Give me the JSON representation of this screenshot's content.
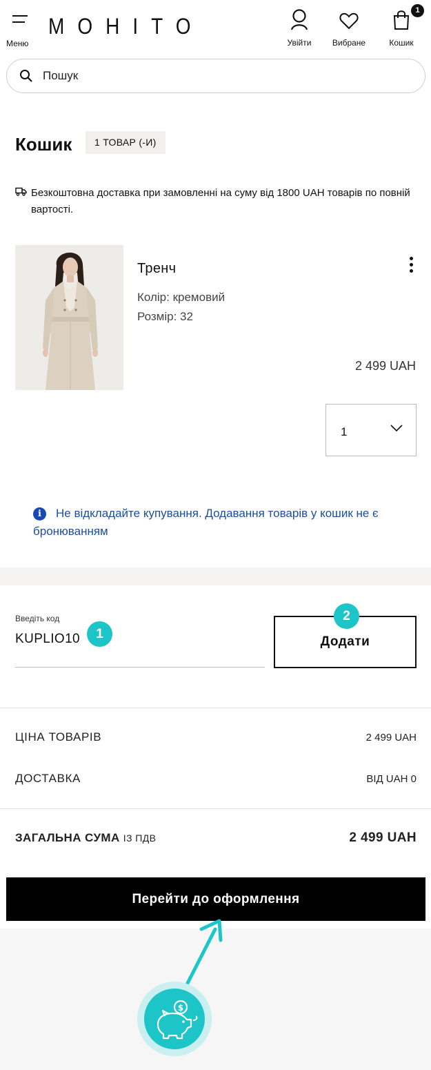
{
  "header": {
    "menu_label": "Меню",
    "logo": "MOHITO",
    "login_label": "Увійти",
    "favorites_label": "Вибране",
    "cart_label": "Кошик",
    "cart_count": "1"
  },
  "search": {
    "placeholder": "Пошук"
  },
  "cart": {
    "title": "Кошик",
    "count_badge": "1 ТОВАР (-И)",
    "delivery_note": "Безкоштовна доставка при замовленні на суму від 1800 UAH товарів по повній вартості."
  },
  "product": {
    "name": "Тренч",
    "color": "Колір: кремовий",
    "size": "Розмір: 32",
    "price": "2 499 UAH",
    "quantity": "1"
  },
  "info_note": "Не відкладайте купування. Додавання товарів у кошик не є бронюванням",
  "promo": {
    "label": "Введіть код",
    "value": "KUPLIO10",
    "add_button": "Додати",
    "step1": "1",
    "step2": "2"
  },
  "summary": {
    "items_label": "ЦІНА ТОВАРІВ",
    "items_value": "2 499 UAH",
    "delivery_label": "ДОСТАВКА",
    "delivery_value": "ВІД UAH 0",
    "total_label": "ЗАГАЛЬНА СУМА",
    "total_suffix": "ІЗ ПДВ",
    "total_value": "2 499 UAH"
  },
  "checkout_button": "Перейти до оформлення",
  "colors": {
    "accent": "#1ec5c8",
    "info_blue": "#1b4e9e",
    "badge_bg": "#f2efec"
  }
}
